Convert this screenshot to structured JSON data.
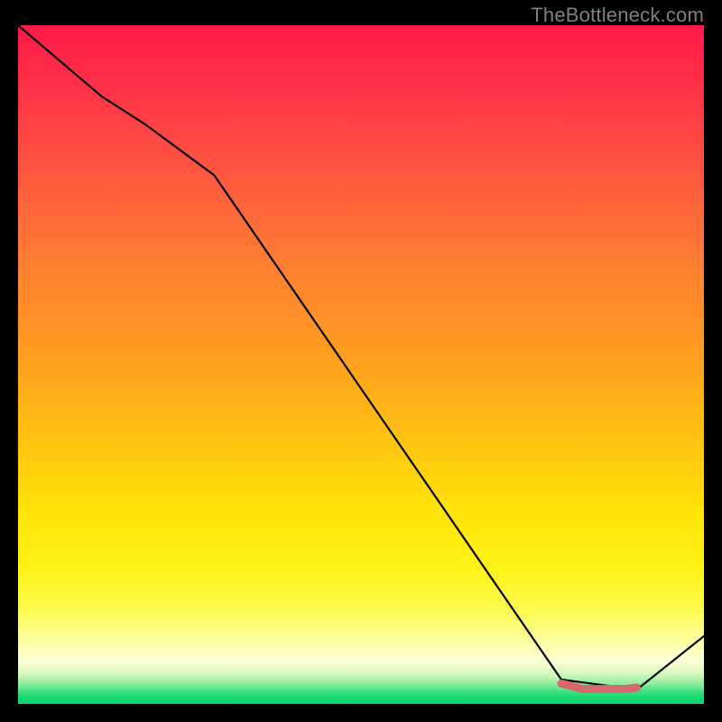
{
  "watermark": "TheBottleneck.com",
  "chart_data": {
    "type": "line",
    "title": "",
    "xlabel": "",
    "ylabel": "",
    "xlim": [
      0,
      100
    ],
    "ylim": [
      0,
      100
    ],
    "series": [
      {
        "name": "main-curve",
        "color": "#000000",
        "x": [
          0,
          12.2,
          18.4,
          28.6,
          79.2,
          90.2,
          100
        ],
        "y": [
          100,
          89.5,
          85.5,
          77.9,
          3.6,
          2.1,
          10.0
        ]
      },
      {
        "name": "highlight-segment",
        "color": "#d4696d",
        "x": [
          79.2,
          82.4,
          88.6,
          90.2
        ],
        "y": [
          3.0,
          2.2,
          2.2,
          2.4
        ]
      }
    ]
  }
}
